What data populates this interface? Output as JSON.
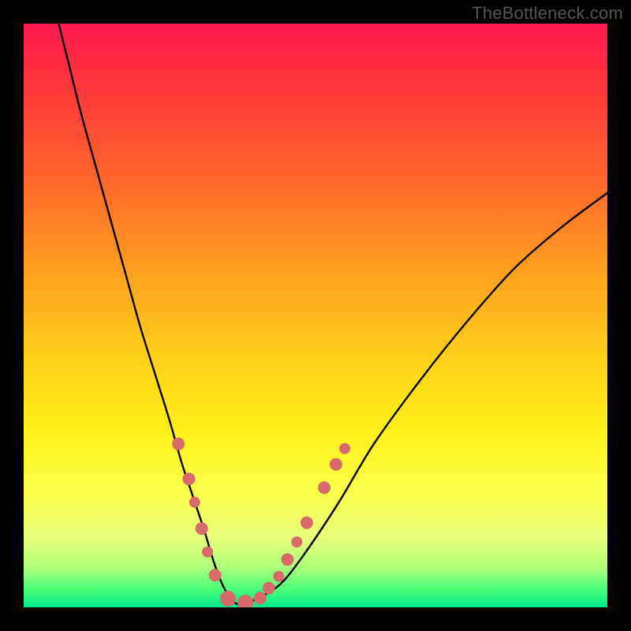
{
  "watermark": "TheBottleneck.com",
  "chart_data": {
    "type": "line",
    "title": "",
    "xlabel": "",
    "ylabel": "",
    "xlim": [
      0,
      100
    ],
    "ylim": [
      0,
      100
    ],
    "grid": false,
    "legend": false,
    "series": [
      {
        "name": "bottleneck-curve",
        "x": [
          6,
          8,
          10,
          12.5,
          15,
          17.5,
          20,
          22.5,
          25,
          27,
          29,
          31,
          32.5,
          34,
          35.5,
          37,
          40,
          44,
          48,
          54,
          60,
          68,
          76,
          84,
          92,
          100
        ],
        "y": [
          100,
          92,
          84,
          75,
          66,
          57,
          48,
          40,
          32,
          25,
          19,
          13,
          8,
          4,
          1.5,
          0.5,
          1.5,
          4,
          9,
          18,
          28,
          39,
          49,
          58,
          65,
          71
        ]
      }
    ],
    "markers": {
      "name": "highlight-dots",
      "color": "#d86a6a",
      "points": [
        {
          "x": 26.5,
          "y": 28,
          "r": 8
        },
        {
          "x": 28.3,
          "y": 22,
          "r": 8
        },
        {
          "x": 29.3,
          "y": 18,
          "r": 7
        },
        {
          "x": 30.5,
          "y": 13.5,
          "r": 8
        },
        {
          "x": 31.5,
          "y": 9.5,
          "r": 7
        },
        {
          "x": 32.8,
          "y": 5.5,
          "r": 8
        },
        {
          "x": 35.0,
          "y": 1.5,
          "r": 10
        },
        {
          "x": 38.0,
          "y": 0.8,
          "r": 10
        },
        {
          "x": 40.5,
          "y": 1.6,
          "r": 8
        },
        {
          "x": 42.0,
          "y": 3.3,
          "r": 8
        },
        {
          "x": 43.7,
          "y": 5.3,
          "r": 7
        },
        {
          "x": 45.2,
          "y": 8.2,
          "r": 8
        },
        {
          "x": 46.8,
          "y": 11.2,
          "r": 7
        },
        {
          "x": 48.5,
          "y": 14.5,
          "r": 8
        },
        {
          "x": 51.5,
          "y": 20.5,
          "r": 8
        },
        {
          "x": 53.5,
          "y": 24.5,
          "r": 8
        },
        {
          "x": 55.0,
          "y": 27.2,
          "r": 7
        }
      ]
    },
    "background_gradient": {
      "top": "#ff1a4d",
      "mid": "#ffd21a",
      "bottom": "#00e88a"
    }
  }
}
